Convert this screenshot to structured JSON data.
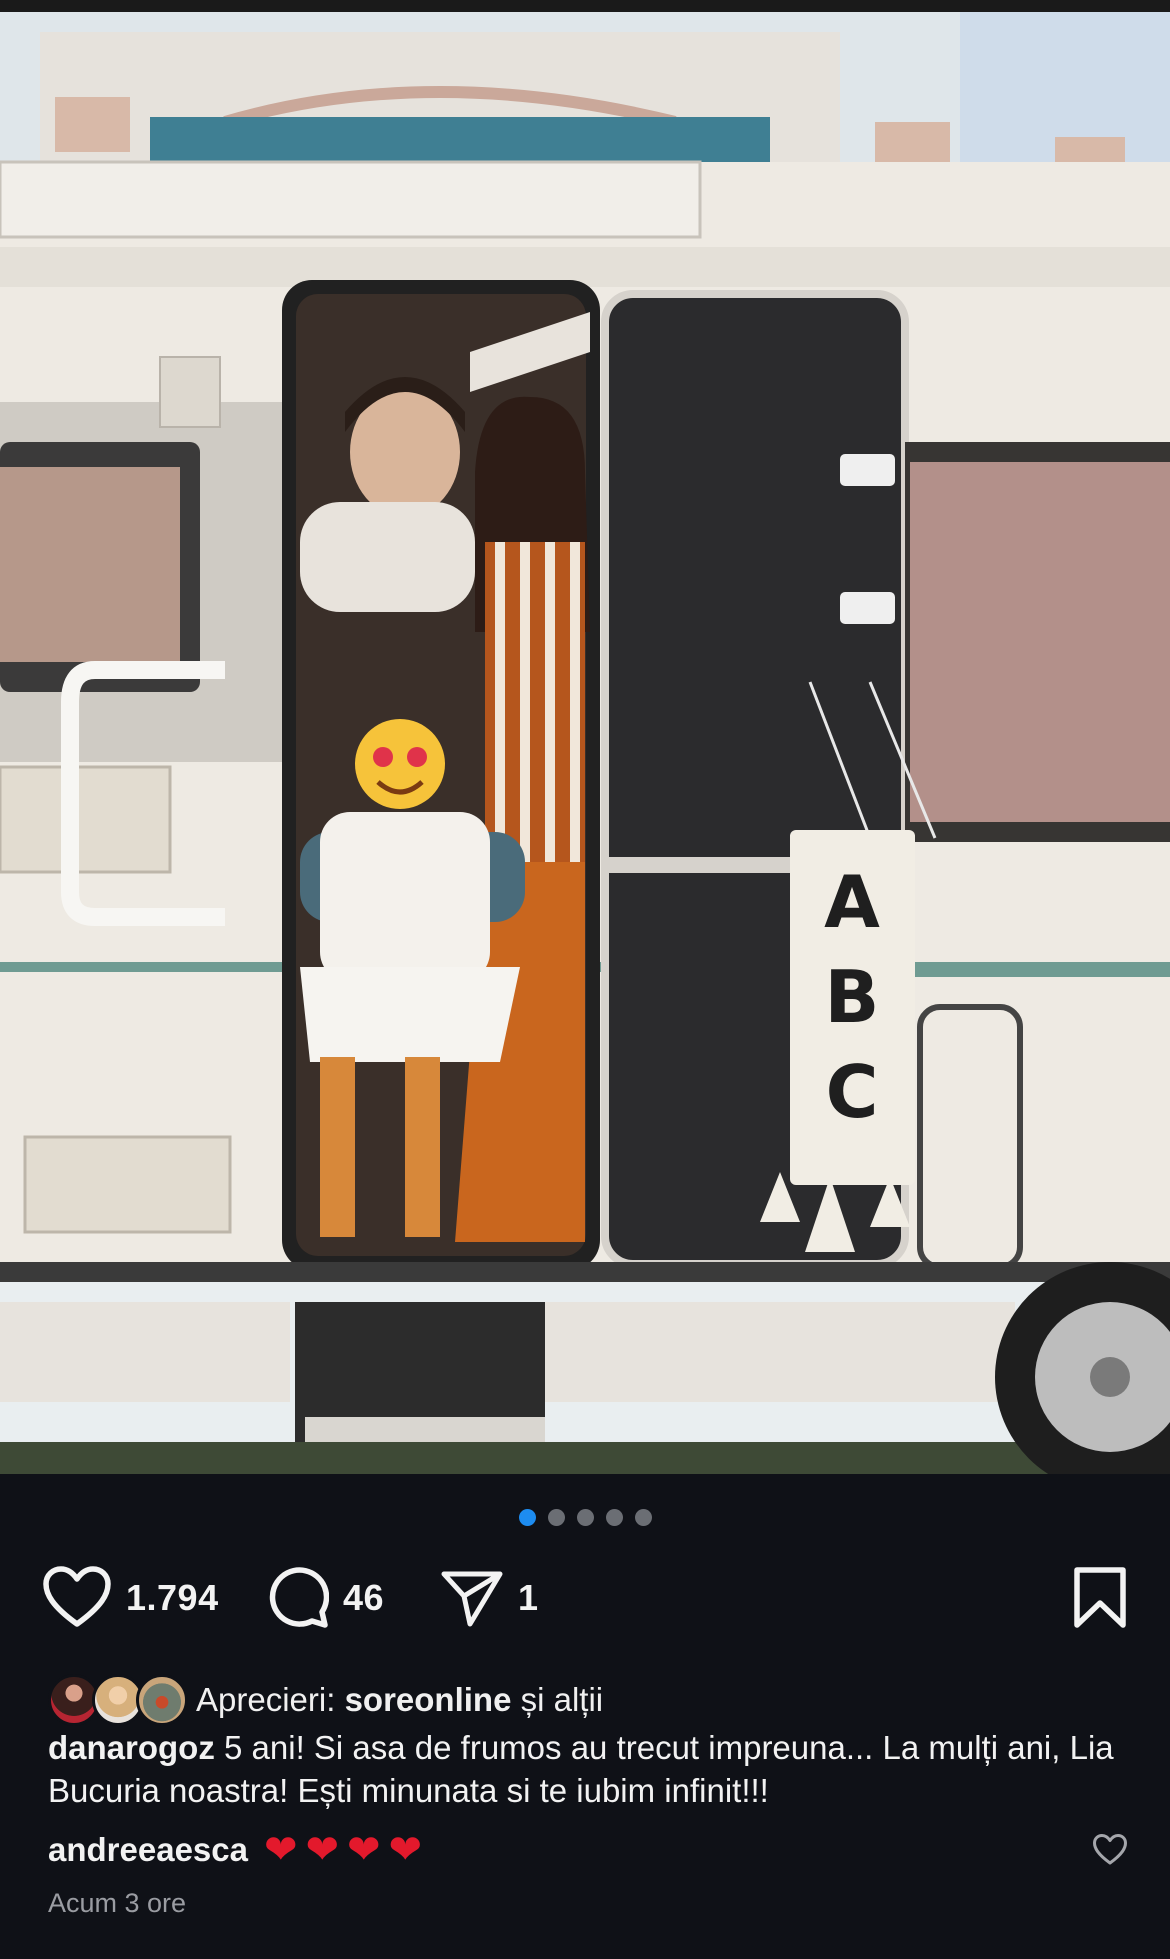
{
  "post": {
    "carousel": {
      "count": 5,
      "active_index": 0
    },
    "actions": {
      "like_count": "1.794",
      "comment_count": "46",
      "share_count": "1"
    },
    "likes": {
      "prefix": "Aprecieri: ",
      "user": "soreonline",
      "suffix": " și alții"
    },
    "caption": {
      "username": "danarogoz",
      "text": " 5 ani! Si asa de frumos au trecut impreuna... La mulți ani, Lia Bucuria noastra! Ești minunata si te iubim infinit!!!"
    },
    "top_comment": {
      "username": "andreeaesca",
      "hearts": [
        "❤",
        "❤",
        "❤",
        "❤"
      ]
    },
    "timestamp": "Acum 3 ore",
    "photo": {
      "banner_letters": [
        "A",
        "B",
        "C"
      ]
    }
  },
  "colors": {
    "background": "#0f1117",
    "active_dot": "#1d8cf0",
    "heart": "#e3192c"
  }
}
